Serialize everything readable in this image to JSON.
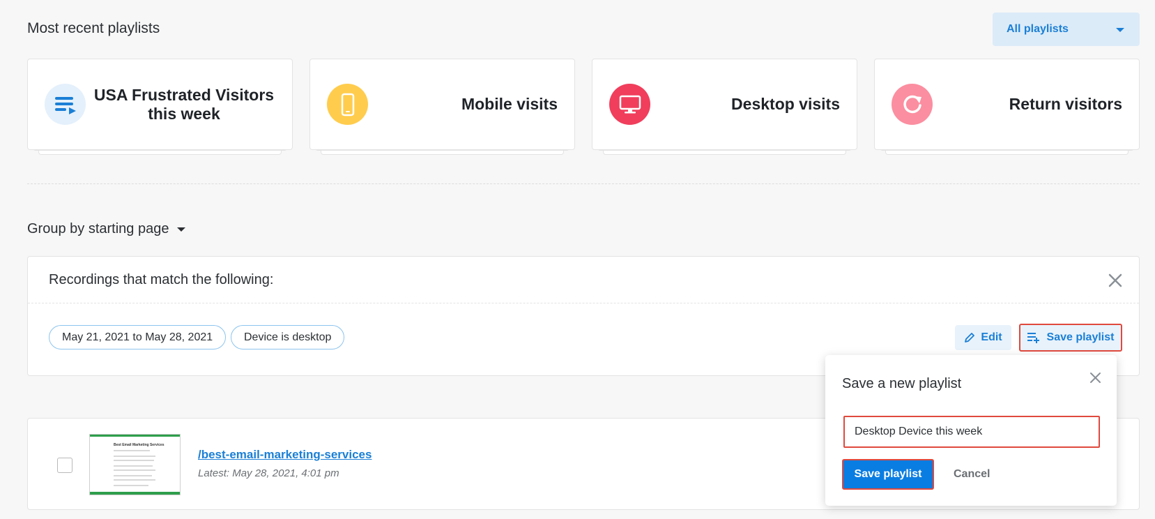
{
  "header": {
    "title": "Most recent playlists",
    "filter_value": "All playlists"
  },
  "playlists": [
    {
      "label": "USA Frustrated Visitors this week",
      "icon": "playlist-icon",
      "color": "#e4f0fb"
    },
    {
      "label": "Mobile visits",
      "icon": "mobile-icon",
      "color": "#ffcc4d"
    },
    {
      "label": "Desktop visits",
      "icon": "desktop-icon",
      "color": "#f03e5c"
    },
    {
      "label": "Return visitors",
      "icon": "refresh-icon",
      "color": "#fb8ea0"
    }
  ],
  "group_by": {
    "label": "Group by starting page"
  },
  "filters": {
    "heading": "Recordings that match the following:",
    "chips": [
      "May 21, 2021 to May 28, 2021",
      "Device is desktop"
    ],
    "edit_label": "Edit",
    "save_label": "Save playlist"
  },
  "recording": {
    "path": "/best-email-marketing-services",
    "latest": "Latest: May 28, 2021, 4:01 pm",
    "thumb_title": "Best Email Marketing Services"
  },
  "popup": {
    "title": "Save a new playlist",
    "input_value": "Desktop Device this week",
    "save_label": "Save playlist",
    "cancel_label": "Cancel"
  },
  "colors": {
    "accent": "#0a7de2",
    "highlight": "#e0493d"
  }
}
